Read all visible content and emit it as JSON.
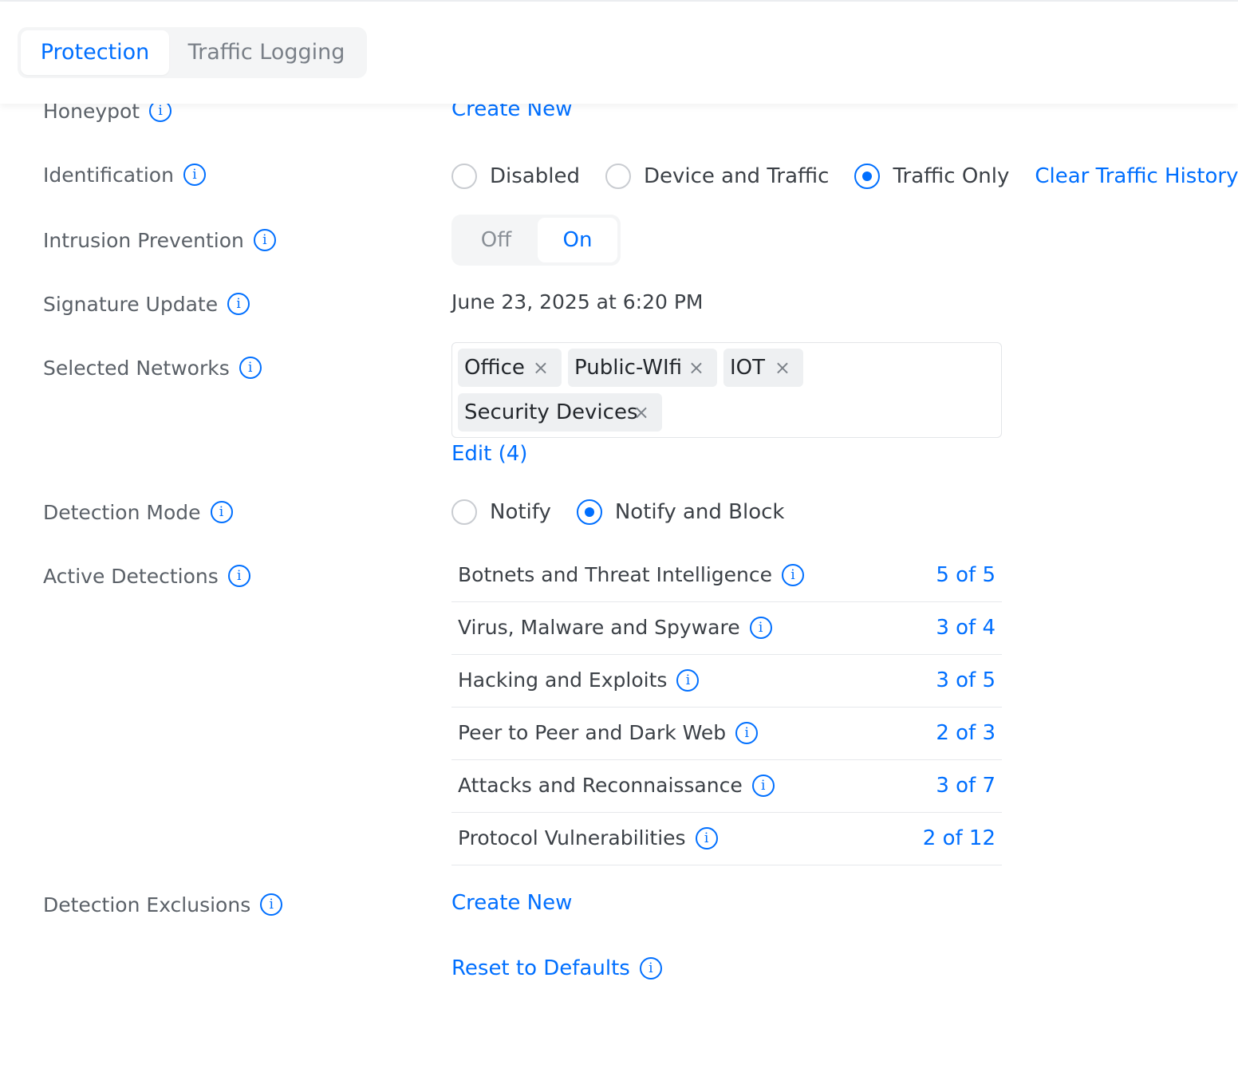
{
  "tabs": [
    {
      "label": "Protection",
      "active": true
    },
    {
      "label": "Traffic Logging",
      "active": false
    }
  ],
  "honeypot": {
    "label": "Honeypot",
    "action": "Create New"
  },
  "identification": {
    "label": "Identification",
    "options": [
      "Disabled",
      "Device and Traffic",
      "Traffic Only"
    ],
    "selected": "Traffic Only",
    "clear_link": "Clear Traffic History"
  },
  "intrusion_prevention": {
    "label": "Intrusion Prevention",
    "off_label": "Off",
    "on_label": "On",
    "value": "On"
  },
  "signature_update": {
    "label": "Signature Update",
    "value": "June 23, 2025 at 6:20 PM"
  },
  "selected_networks": {
    "label": "Selected Networks",
    "networks": [
      "Office",
      "Public-WIfi",
      "IOT",
      "Security Devices"
    ],
    "remove_glyph": "×",
    "edit_label": "Edit (4)"
  },
  "detection_mode": {
    "label": "Detection Mode",
    "options": [
      "Notify",
      "Notify and Block"
    ],
    "selected": "Notify and Block"
  },
  "active_detections": {
    "label": "Active Detections",
    "items": [
      {
        "name": "Botnets and Threat Intelligence",
        "count": "5 of 5"
      },
      {
        "name": "Virus, Malware and Spyware",
        "count": "3 of 4"
      },
      {
        "name": "Hacking and Exploits",
        "count": "3 of 5"
      },
      {
        "name": "Peer to Peer and Dark Web",
        "count": "2 of 3"
      },
      {
        "name": "Attacks and Reconnaissance",
        "count": "3 of 7"
      },
      {
        "name": "Protocol Vulnerabilities",
        "count": "2 of 12"
      }
    ]
  },
  "detection_exclusions": {
    "label": "Detection Exclusions",
    "action": "Create New"
  },
  "reset": {
    "label": "Reset to Defaults"
  },
  "icons": {
    "info": "info-icon",
    "remove": "close-icon"
  },
  "colors": {
    "accent": "#006fff",
    "label_text": "#5b6168",
    "value_text": "#3c4147",
    "chip_bg": "#eef0f2"
  }
}
